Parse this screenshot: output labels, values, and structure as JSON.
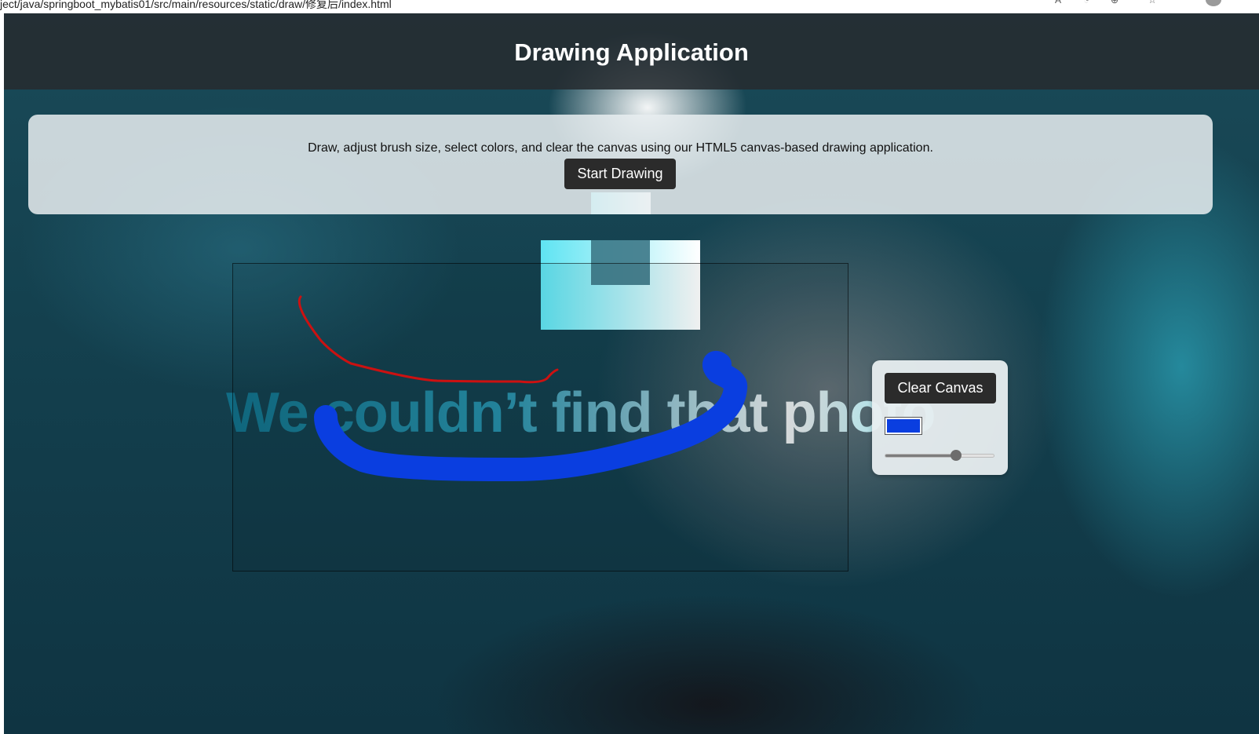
{
  "browser": {
    "url": "ject/java/springboot_mybatis01/src/main/resources/static/draw/修复后/index.html"
  },
  "page": {
    "title": "Drawing Application",
    "intro_text": "Draw, adjust brush size, select colors, and clear the canvas using our HTML5 canvas-based drawing application.",
    "start_button_label": "Start Drawing"
  },
  "background_photo": {
    "error_message": "We couldn’t find that photo"
  },
  "controls": {
    "clear_button_label": "Clear Canvas",
    "selected_color": "#0a3ee0",
    "brush_size_fraction": 0.65
  },
  "canvas_strokes": [
    {
      "color": "#cc1111",
      "width": "thin"
    },
    {
      "color": "#0a3ee0",
      "width": "thick"
    }
  ]
}
